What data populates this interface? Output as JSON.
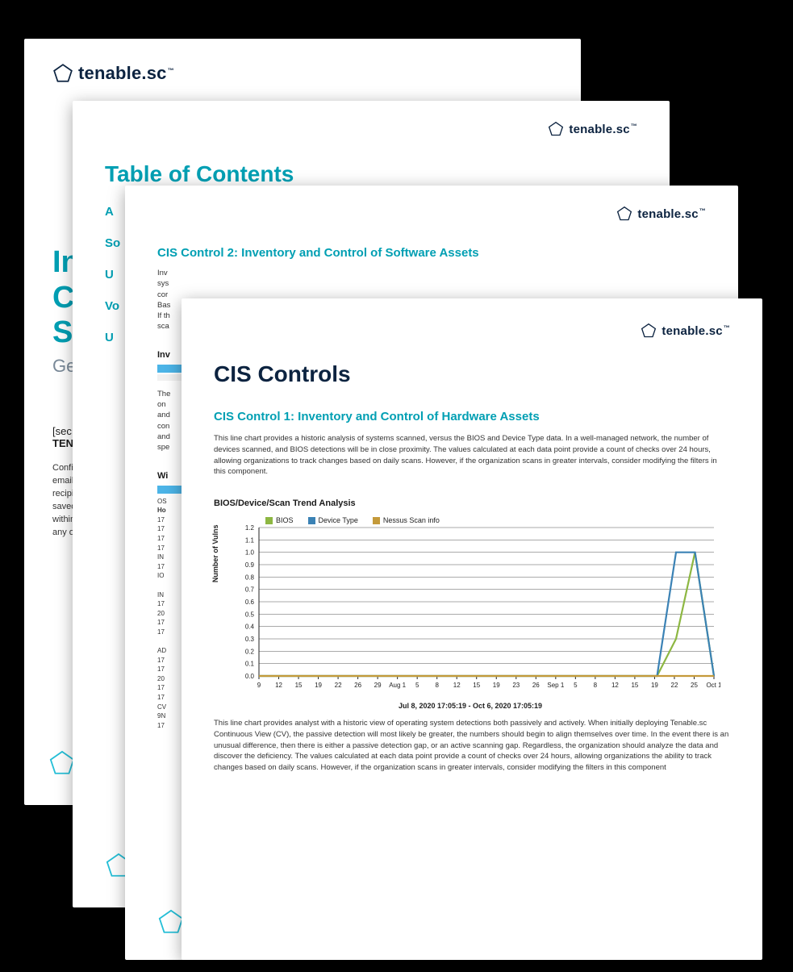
{
  "brand": {
    "name": "tenable.sc"
  },
  "colors": {
    "teal": "#009fb3",
    "navy": "#0c2340",
    "series_bios": "#8db742",
    "series_device": "#3b82b5",
    "series_nessus": "#c49a3a"
  },
  "page1": {
    "title_line1": "In",
    "title_line2": "C",
    "title_line3": "S",
    "subtitle_prefix": "Ge",
    "sec_open": "[sec",
    "sec_bold": "TEN",
    "conf": "Confi\nemail\nrecipi\nsaved\nwithin\nany o"
  },
  "page2": {
    "heading": "Table of Contents",
    "items": [
      "A",
      "So",
      "U",
      "Vo",
      "U"
    ]
  },
  "page3": {
    "heading": "CIS Control 2: Inventory and Control of Software Assets",
    "intro": "Inv\nsys\ncor\nBas\nIf th\nsca",
    "sub1": "Inv",
    "para": "The\non\nand\ncon\nand\nspe",
    "sub2": "Wi",
    "col0": "OS",
    "col0b": "Ho",
    "rows": [
      "17",
      "17",
      "17",
      "17",
      "IN",
      "17",
      "IO",
      "",
      "IN",
      "17",
      "20",
      "17",
      "17",
      "",
      "AD",
      "17",
      "17",
      "20",
      "17",
      "17",
      "CV",
      "9N",
      "17"
    ]
  },
  "page4": {
    "title": "CIS Controls",
    "heading": "CIS Control 1: Inventory and Control of Hardware Assets",
    "para1": "This line chart provides a historic analysis of systems scanned, versus the BIOS and Device Type data. In a well-managed network, the number of devices scanned, and BIOS detections will be in close proximity. The values calculated at each data point provide a count of checks over 24 hours, allowing organizations to track changes based on daily scans. However, if the organization scans in greater intervals, consider modifying the filters in this component.",
    "chart_title": "BIOS/Device/Scan Trend Analysis",
    "para2": "This line chart provides analyst with a historic view of operating system detections both passively and actively. When initially deploying Tenable.sc Continuous View (CV), the passive detection will most likely be greater, the numbers should begin to align themselves over time. In the event there is an unusual difference, then there is either a passive detection gap, or an active scanning gap. Regardless, the organization should analyze the data and discover the deficiency. The values calculated at each data point provide a count of checks over 24 hours, allowing organizations the ability to track changes based on daily scans. However, if the organization scans in greater intervals, consider modifying the filters in this component",
    "legend": {
      "bios": "BIOS",
      "device": "Device Type",
      "nessus": "Nessus Scan info"
    },
    "ylabel": "Number of Vulns",
    "xcaption": "Jul 8, 2020 17:05:19 - Oct 6, 2020 17:05:19"
  },
  "chart_data": {
    "type": "line",
    "ylabel": "Number of Vulns",
    "ylim": [
      0.0,
      1.2
    ],
    "yticks": [
      0.0,
      0.1,
      0.2,
      0.3,
      0.4,
      0.5,
      0.6,
      0.7,
      0.8,
      0.9,
      1.0,
      1.1,
      1.2
    ],
    "x_labels": [
      "9",
      "12",
      "15",
      "19",
      "22",
      "26",
      "29",
      "Aug 1",
      "5",
      "8",
      "12",
      "15",
      "19",
      "23",
      "26",
      "Sep 1",
      "5",
      "8",
      "12",
      "15",
      "19",
      "22",
      "25",
      "Oct 1"
    ],
    "x": [
      0,
      1,
      2,
      3,
      4,
      5,
      6,
      7,
      8,
      9,
      10,
      11,
      12,
      13,
      14,
      15,
      16,
      17,
      18,
      19,
      20,
      21,
      22,
      23,
      24
    ],
    "series": [
      {
        "name": "BIOS",
        "color": "#8db742",
        "values": [
          0,
          0,
          0,
          0,
          0,
          0,
          0,
          0,
          0,
          0,
          0,
          0,
          0,
          0,
          0,
          0,
          0,
          0,
          0,
          0,
          0,
          0,
          0.3,
          1.0,
          0
        ]
      },
      {
        "name": "Device Type",
        "color": "#3b82b5",
        "values": [
          0,
          0,
          0,
          0,
          0,
          0,
          0,
          0,
          0,
          0,
          0,
          0,
          0,
          0,
          0,
          0,
          0,
          0,
          0,
          0,
          0,
          0,
          1.0,
          1.0,
          0
        ]
      },
      {
        "name": "Nessus Scan info",
        "color": "#c49a3a",
        "values": [
          0,
          0,
          0,
          0,
          0,
          0,
          0,
          0,
          0,
          0,
          0,
          0,
          0,
          0,
          0,
          0,
          0,
          0,
          0,
          0,
          0,
          0,
          0,
          0,
          0
        ]
      }
    ],
    "title": "BIOS/Device/Scan Trend Analysis",
    "xcaption": "Jul 8, 2020 17:05:19 - Oct 6, 2020 17:05:19"
  }
}
